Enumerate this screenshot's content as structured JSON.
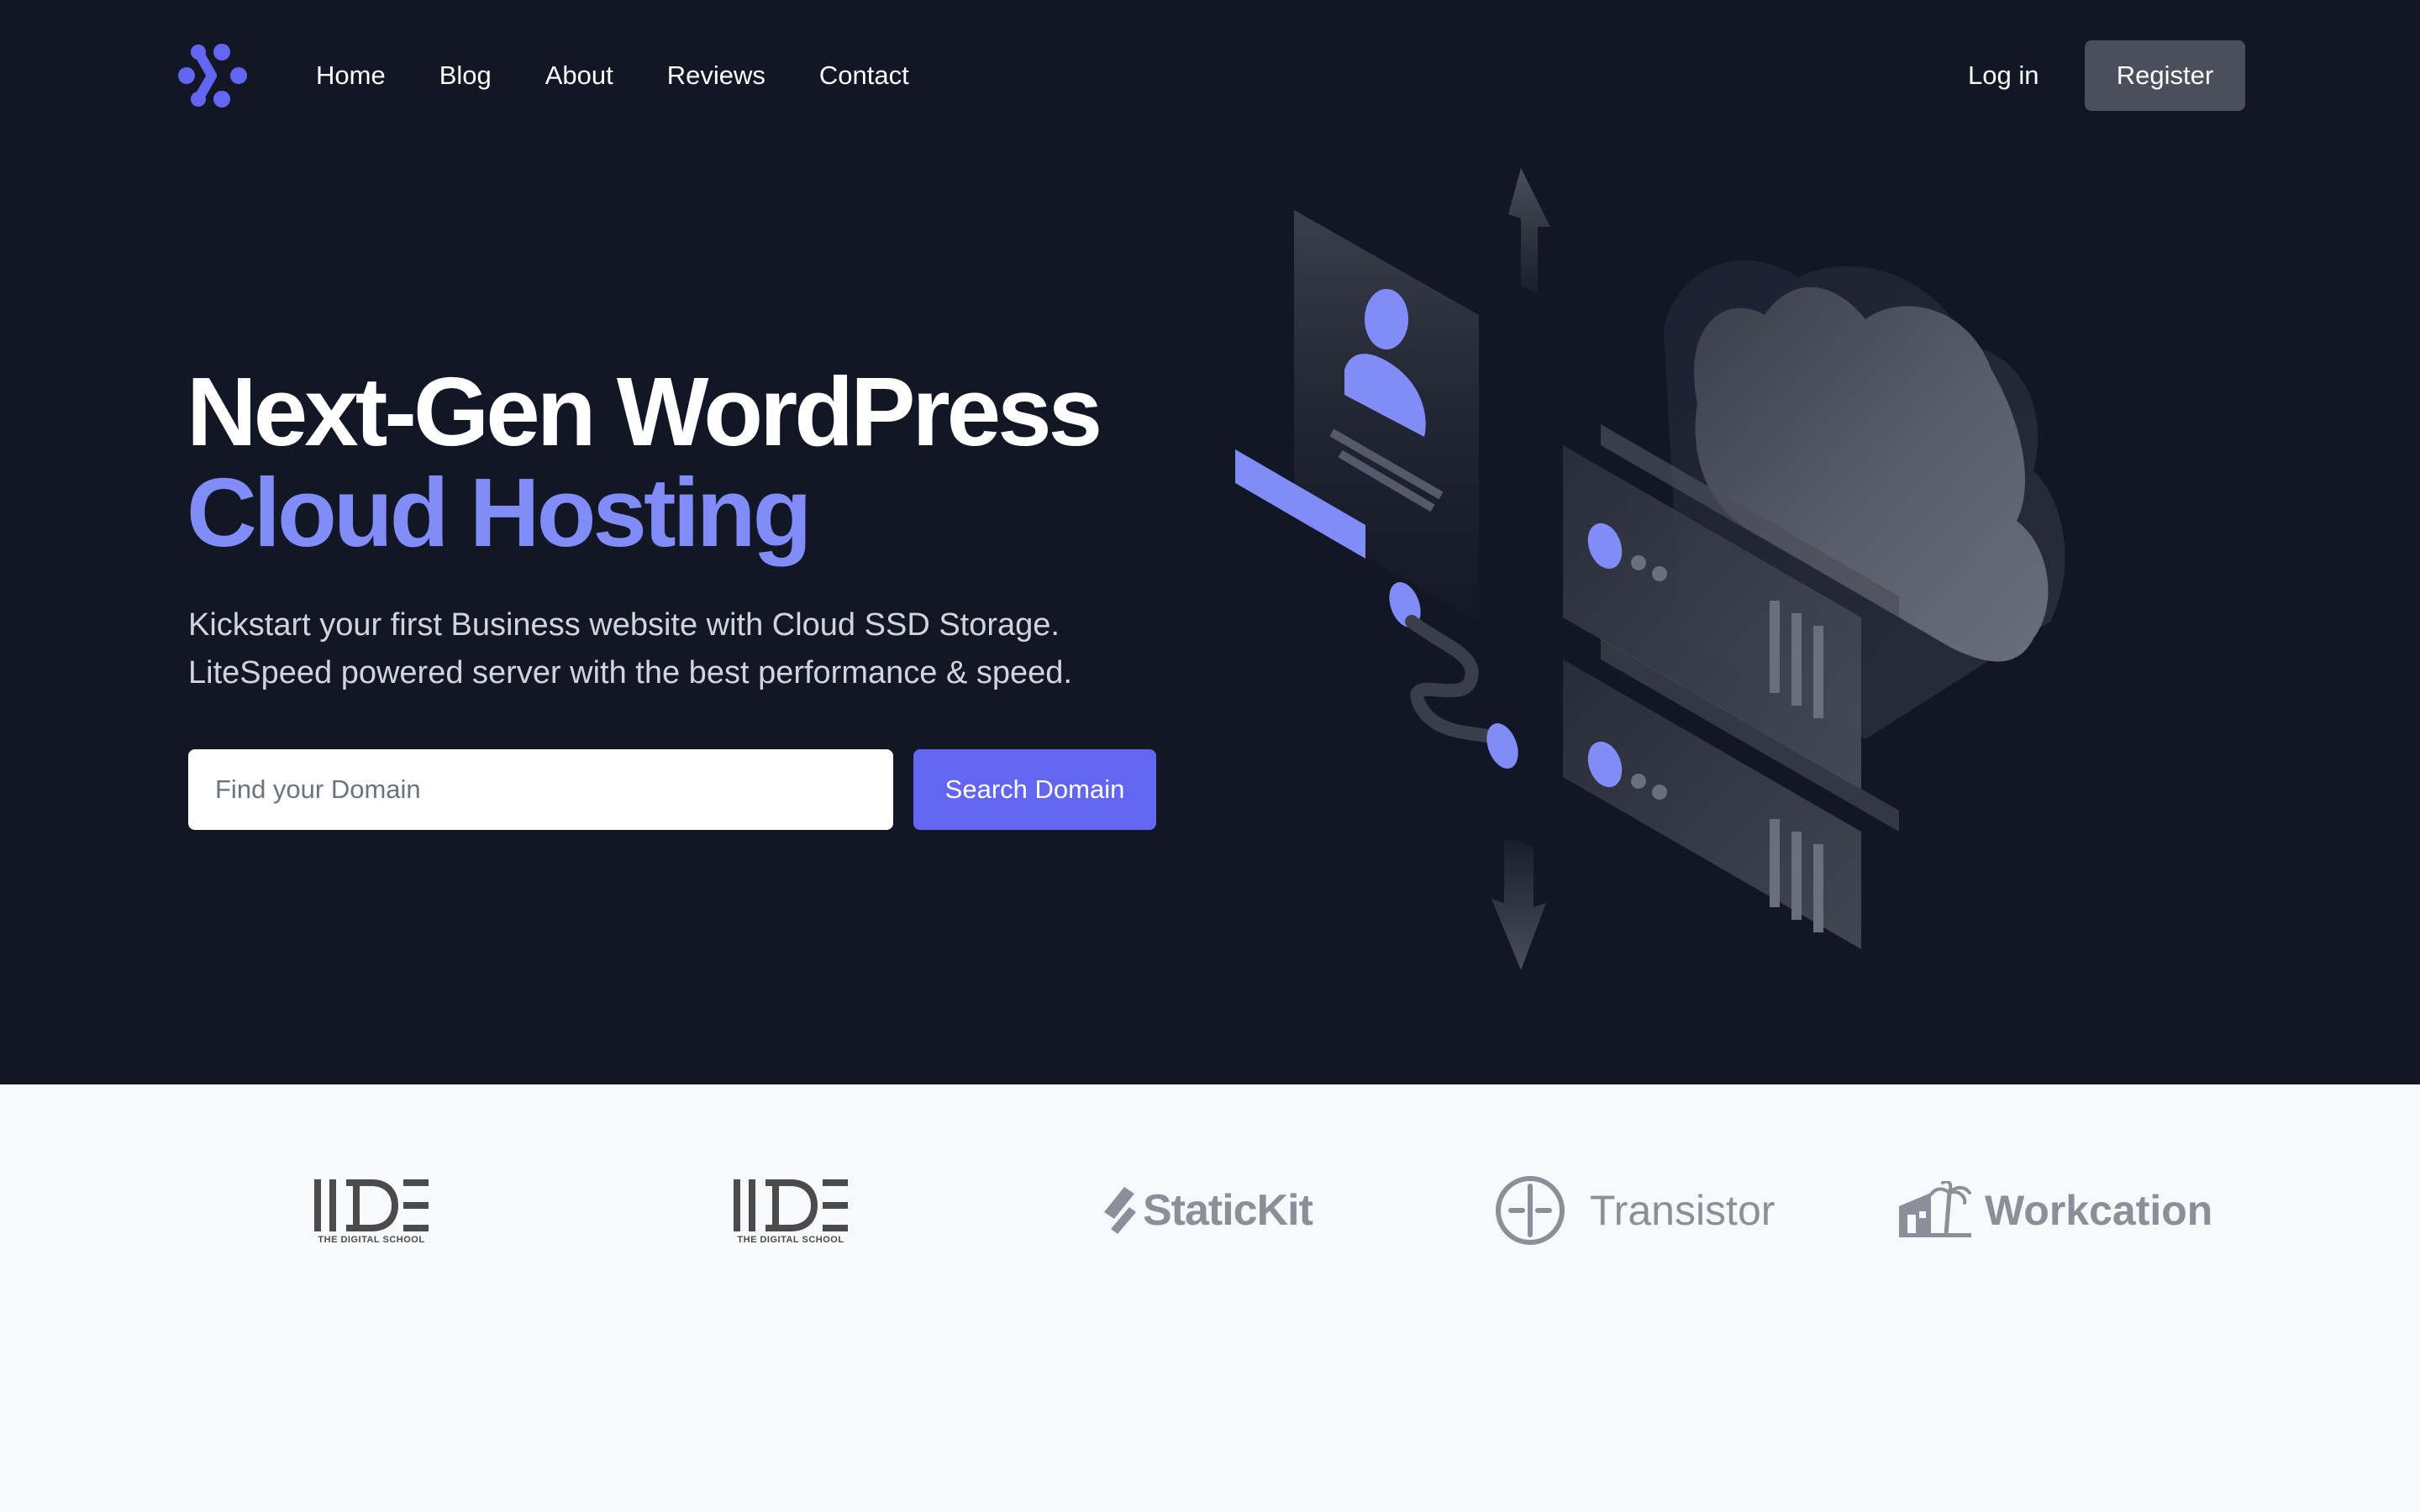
{
  "nav": {
    "links": [
      "Home",
      "Blog",
      "About",
      "Reviews",
      "Contact"
    ],
    "login_label": "Log in",
    "register_label": "Register"
  },
  "hero": {
    "headline_line1": "Next-Gen WordPress",
    "headline_line2": "Cloud Hosting",
    "subtext_line1": "Kickstart your first Business website with Cloud SSD Storage.",
    "subtext_line2": "LiteSpeed powered server with the best performance & speed.",
    "search_placeholder": "Find your Domain",
    "search_value": "",
    "search_button_label": "Search Domain"
  },
  "logos": {
    "items": [
      {
        "name": "IIDE",
        "subtitle": "THE DIGITAL SCHOOL",
        "icon": "iide-logo"
      },
      {
        "name": "IIDE",
        "subtitle": "THE DIGITAL SCHOOL",
        "icon": "iide-logo"
      },
      {
        "name": "StaticKit",
        "icon": "statickit-logo"
      },
      {
        "name": "Transistor",
        "icon": "transistor-logo"
      },
      {
        "name": "Workcation",
        "icon": "workcation-logo"
      }
    ]
  },
  "colors": {
    "hero_bg": "#121726",
    "accent": "#6366f1",
    "accent_light": "#818cf8",
    "register_bg": "#4a4f5c",
    "logos_bg": "#f8f9fb",
    "logo_gray": "#8a8f99"
  }
}
